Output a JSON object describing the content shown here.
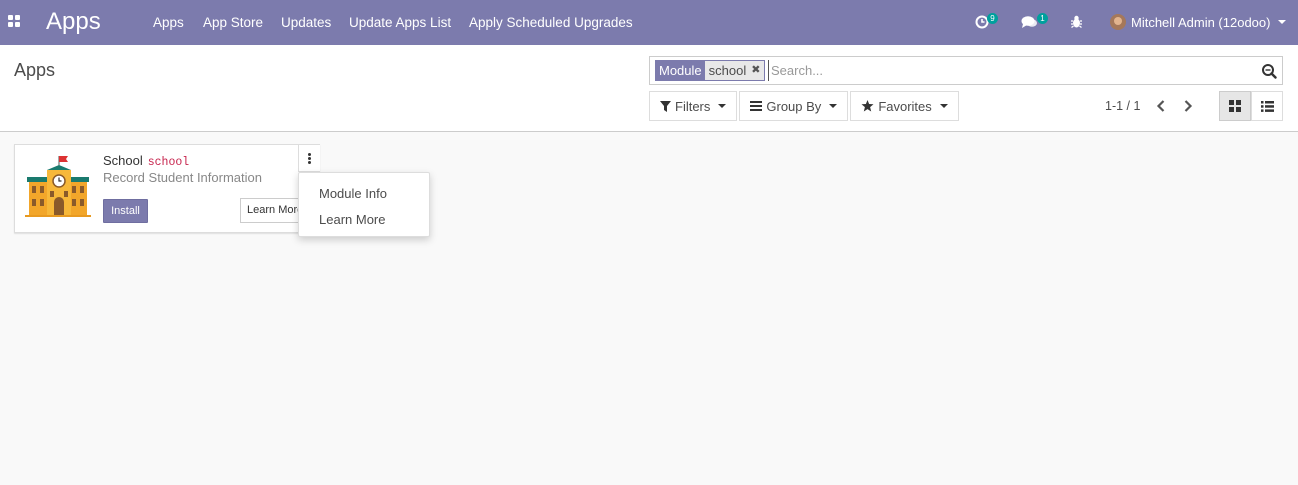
{
  "navbar": {
    "brand": "Apps",
    "menu": [
      "Apps",
      "App Store",
      "Updates",
      "Update Apps List",
      "Apply Scheduled Upgrades"
    ],
    "activity_count": "9",
    "messages_count": "1",
    "user_name": "Mitchell Admin (12odoo)"
  },
  "control_panel": {
    "title": "Apps",
    "search": {
      "facet_label": "Module",
      "facet_value": "school",
      "placeholder": "Search..."
    },
    "filters_label": "Filters",
    "group_by_label": "Group By",
    "favorites_label": "Favorites",
    "pager": "1-1 / 1"
  },
  "card": {
    "name": "School",
    "technical_name": "school",
    "summary": "Record Student Information",
    "install_label": "Install",
    "learn_more_label": "Learn More"
  },
  "dropdown": {
    "items": [
      "Module Info",
      "Learn More"
    ]
  },
  "colors": {
    "brand": "#7c7bad",
    "badge": "#00a09d",
    "technical_name": "#c7254e"
  }
}
